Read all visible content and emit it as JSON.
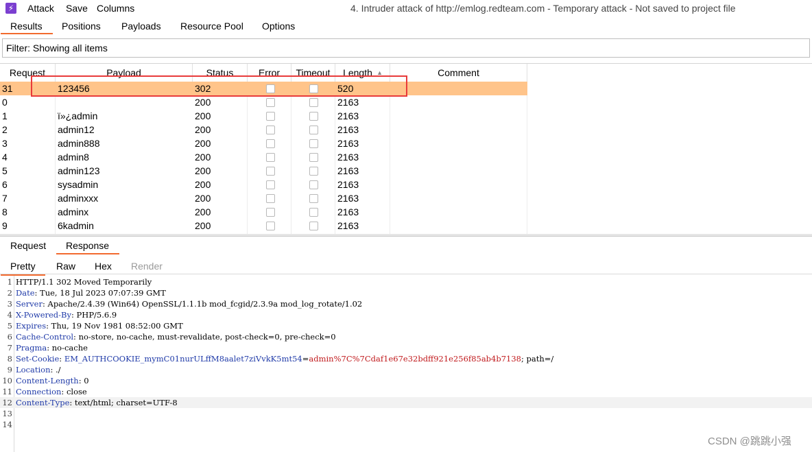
{
  "menubar": {
    "items": [
      "Attack",
      "Save",
      "Columns"
    ],
    "window_title": "4. Intruder attack of http://emlog.redteam.com - Temporary attack - Not saved to project file"
  },
  "tabs": [
    "Results",
    "Positions",
    "Payloads",
    "Resource Pool",
    "Options"
  ],
  "filter": "Filter: Showing all items",
  "table": {
    "columns": [
      "Request",
      "Payload",
      "Status",
      "Error",
      "Timeout",
      "Length",
      "Comment"
    ],
    "rows": [
      {
        "request": "31",
        "payload": "123456",
        "status": "302",
        "length": "520"
      },
      {
        "request": "0",
        "payload": "",
        "status": "200",
        "length": "2163"
      },
      {
        "request": "1",
        "payload": "ï»¿admin",
        "status": "200",
        "length": "2163"
      },
      {
        "request": "2",
        "payload": "admin12",
        "status": "200",
        "length": "2163"
      },
      {
        "request": "3",
        "payload": "admin888",
        "status": "200",
        "length": "2163"
      },
      {
        "request": "4",
        "payload": "admin8",
        "status": "200",
        "length": "2163"
      },
      {
        "request": "5",
        "payload": "admin123",
        "status": "200",
        "length": "2163"
      },
      {
        "request": "6",
        "payload": "sysadmin",
        "status": "200",
        "length": "2163"
      },
      {
        "request": "7",
        "payload": "adminxxx",
        "status": "200",
        "length": "2163"
      },
      {
        "request": "8",
        "payload": "adminx",
        "status": "200",
        "length": "2163"
      },
      {
        "request": "9",
        "payload": "6kadmin",
        "status": "200",
        "length": "2163"
      }
    ]
  },
  "req_resp_tabs": [
    "Request",
    "Response"
  ],
  "view_tabs": [
    "Pretty",
    "Raw",
    "Hex",
    "Render"
  ],
  "response_lines": [
    {
      "n": "1",
      "key": "",
      "val": "HTTP/1.1 302 Moved Temporarily"
    },
    {
      "n": "2",
      "key": "Date",
      "val": " Tue, 18 Jul 2023 07:07:39 GMT"
    },
    {
      "n": "3",
      "key": "Server",
      "val": " Apache/2.4.39 (Win64) OpenSSL/1.1.1b mod_fcgid/2.3.9a mod_log_rotate/1.02"
    },
    {
      "n": "4",
      "key": "X-Powered-By",
      "val": " PHP/5.6.9"
    },
    {
      "n": "5",
      "key": "Expires",
      "val": " Thu, 19 Nov 1981 08:52:00 GMT"
    },
    {
      "n": "6",
      "key": "Cache-Control",
      "val": " no-store, no-cache, must-revalidate, post-check=0, pre-check=0"
    },
    {
      "n": "7",
      "key": "Pragma",
      "val": " no-cache"
    },
    {
      "n": "8",
      "key": "Set-Cookie",
      "cookie_name": " EM_AUTHCOOKIE_mymC01nurULffM8aalet7ziVvkK5mt54",
      "cookie_value": "admin%7C%7Cdaf1e67e32bdff921e256f85ab4b7138",
      "val": "; path=/"
    },
    {
      "n": "9",
      "key": "Location",
      "val": " ./"
    },
    {
      "n": "10",
      "key": "Content-Length",
      "val": " 0"
    },
    {
      "n": "11",
      "key": "Connection",
      "val": " close"
    },
    {
      "n": "12",
      "key": "Content-Type",
      "val": " text/html; charset=UTF-8"
    },
    {
      "n": "13",
      "key": "",
      "val": ""
    },
    {
      "n": "14",
      "key": "",
      "val": ""
    }
  ],
  "watermark": "CSDN @跳跳小强",
  "colors": {
    "accent": "#f26a2e",
    "selected_row": "#ffc48a",
    "highlight_box": "#e83a3a",
    "header_key": "#1f3aa8",
    "cookie_value": "#c0181b"
  }
}
